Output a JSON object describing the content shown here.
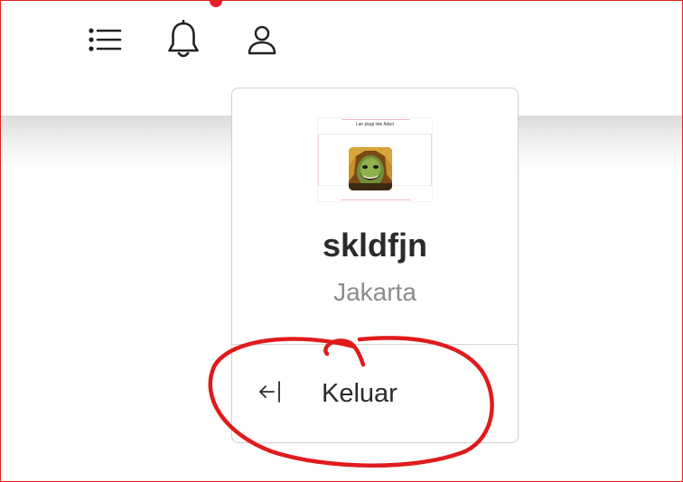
{
  "header": {
    "icons": {
      "menu": "list-icon",
      "notifications": "bell-icon",
      "account": "user-icon"
    },
    "notification_dot_color": "#e4202a"
  },
  "profile_card": {
    "preview_caption": "Lan plugi lole Aduri",
    "username": "skldfjn",
    "location": "Jakarta",
    "logout": {
      "icon": "logout-arrow-icon",
      "label": "Keluar"
    }
  },
  "annotation": {
    "color": "#e01b1b"
  }
}
